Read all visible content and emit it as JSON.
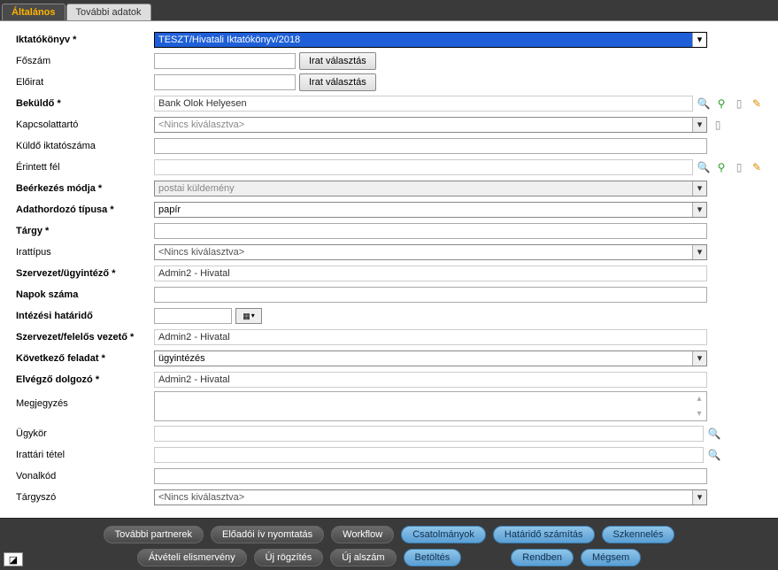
{
  "tabs": {
    "general": "Általános",
    "more": "További adatok"
  },
  "labels": {
    "iktatokonyv": "Iktatókönyv *",
    "foszam": "Főszám",
    "eloirat": "Előirat",
    "bekuldo": "Beküldő *",
    "kapcsolattarto": "Kapcsolattartó",
    "kuldo_iktatoszama": "Küldő iktatószáma",
    "erintett_fel": "Érintett fél",
    "beerkezes_modja": "Beérkezés módja *",
    "adathordozo": "Adathordozó típusa *",
    "targy": "Tárgy *",
    "irattipus": "Irattípus",
    "szervezet_ugyintezo": "Szervezet/ügyintéző *",
    "napok_szama": "Napok száma",
    "intezesi_hatarido": "Intézési határidő",
    "szervezet_felelos": "Szervezet/felelős vezető *",
    "kovetkezo_feladat": "Következő feladat *",
    "elvegzo_dolgozo": "Elvégző dolgozó *",
    "megjegyzes": "Megjegyzés",
    "ugykor": "Ügykör",
    "irattari_tetel": "Irattári tétel",
    "vonalkod": "Vonalkód",
    "targyszo": "Tárgyszó"
  },
  "values": {
    "iktatokonyv": "TESZT/Hivatali Iktatókönyv/2018",
    "foszam": "",
    "eloirat": "",
    "bekuldo": "Bank Olok Helyesen",
    "kapcsolattarto_placeholder": "<Nincs kiválasztva>",
    "kuldo_iktatoszama": "",
    "erintett_fel": "",
    "beerkezes_modja": "postai küldemény",
    "adathordozo": "papír",
    "targy": "",
    "irattipus": "<Nincs kiválasztva>",
    "szervezet_ugyintezo": "Admin2 - Hivatal",
    "napok_szama": "",
    "intezesi_hatarido": "",
    "szervezet_felelos": "Admin2 - Hivatal",
    "kovetkezo_feladat": "ügyintézés",
    "elvegzo_dolgozo": "Admin2 - Hivatal",
    "megjegyzes": "",
    "ugykor": "",
    "irattari_tetel": "",
    "vonalkod": "",
    "targyszo": "<Nincs kiválasztva>"
  },
  "buttons": {
    "irat_valasztas": "Irat választás"
  },
  "footer": {
    "tovabbi_partnerek": "További partnerek",
    "eloadoi_iv": "Előadói ív nyomtatás",
    "workflow": "Workflow",
    "csatolmanyok": "Csatolmányok",
    "hatarido_szamitas": "Határidő számítás",
    "szkenneles": "Szkennelés",
    "atveteli": "Átvételi elismervény",
    "uj_rogzites": "Új rögzítés",
    "uj_alszam": "Új alszám",
    "betoltes": "Betöltés",
    "rendben": "Rendben",
    "megsem": "Mégsem"
  }
}
